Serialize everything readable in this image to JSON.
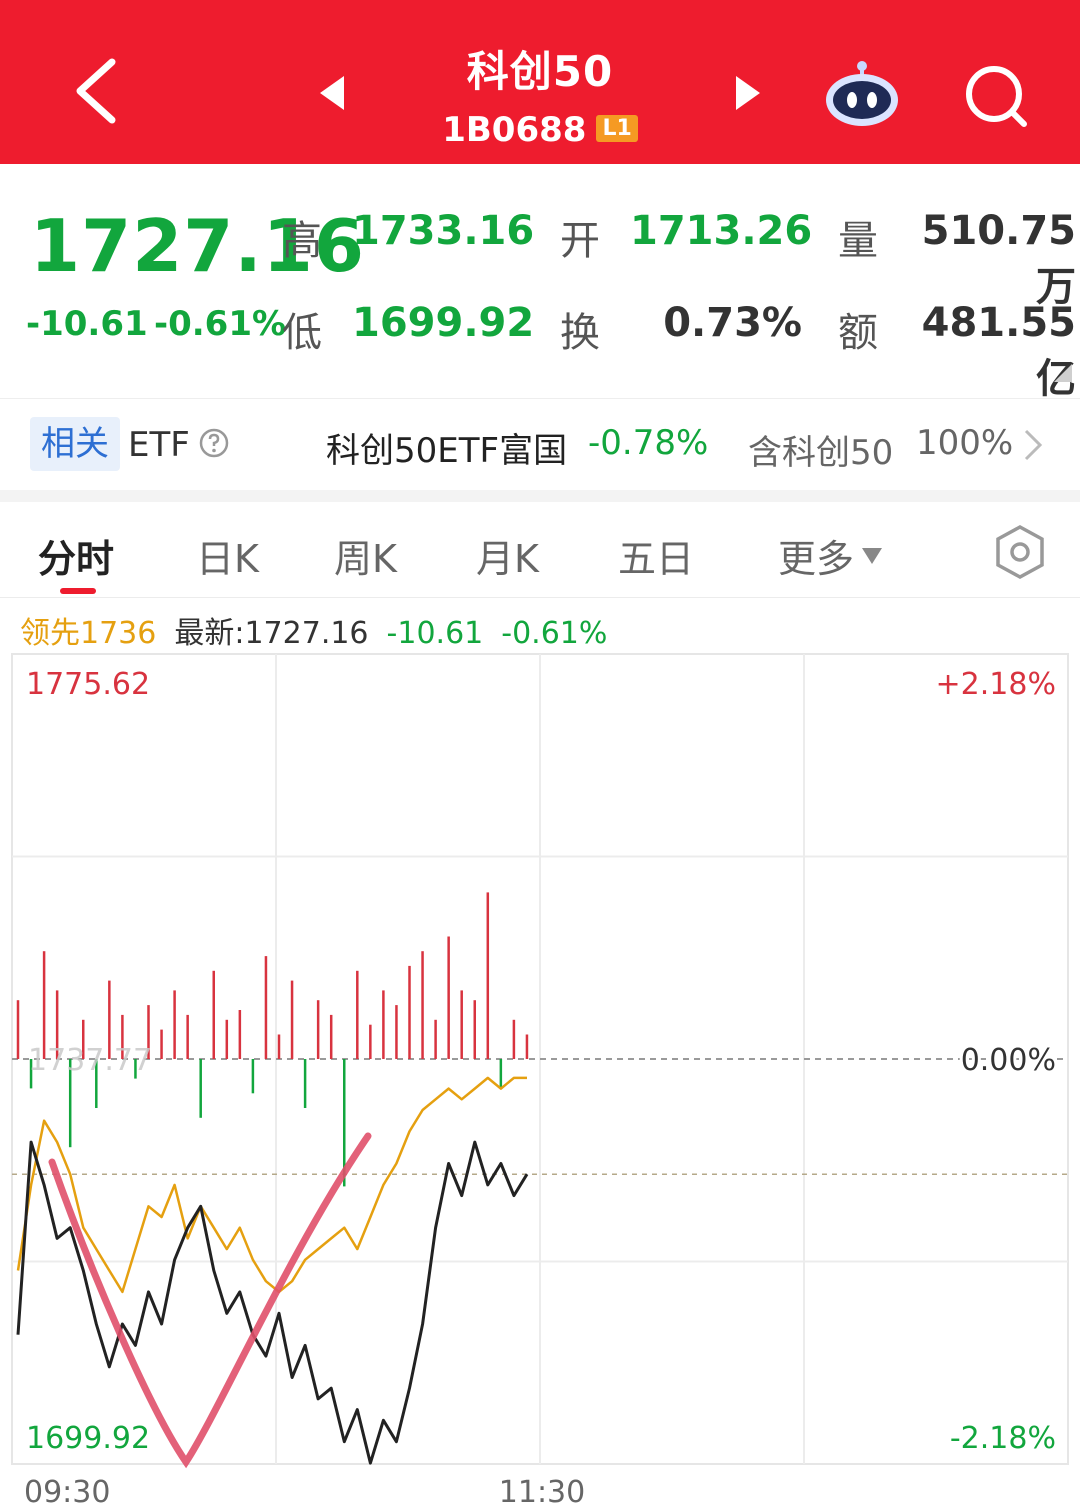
{
  "header": {
    "title": "科创50",
    "code": "1B0688",
    "code_badge": "L1",
    "bg_color": "#ee1c2e"
  },
  "quote": {
    "price": "1727.16",
    "change": "-10.61",
    "change_pct": "-0.61%",
    "high_label": "高",
    "high": "1733.16",
    "open_label": "开",
    "open": "1713.26",
    "volume_label": "量",
    "volume": "510.75万",
    "low_label": "低",
    "low": "1699.92",
    "turnover_label": "换",
    "turnover": "0.73%",
    "amount_label": "额",
    "amount": "481.55亿"
  },
  "etf": {
    "tag": "相关",
    "label": "ETF",
    "name": "科创50ETF富国",
    "change": "-0.78%",
    "contain_label": "含科创50",
    "contain_pct": "100%"
  },
  "tabs": [
    {
      "label": "分时",
      "active": true
    },
    {
      "label": "日K",
      "active": false
    },
    {
      "label": "周K",
      "active": false
    },
    {
      "label": "月K",
      "active": false
    },
    {
      "label": "五日",
      "active": false
    },
    {
      "label": "更多",
      "active": false
    }
  ],
  "info_line": {
    "lead": "领先1736",
    "newest": "最新:1727.16",
    "change": "-10.61",
    "change_pct": "-0.61%"
  },
  "chart_data": {
    "type": "line",
    "y_max_label": "1775.62",
    "y_min_label": "1699.92",
    "y_max_pct": "+2.18%",
    "y_min_pct": "-2.18%",
    "zero_pct": "0.00%",
    "prev_close_label": "1737.77",
    "ylim": [
      1699.92,
      1775.62
    ],
    "prev_close": 1737.77,
    "x_labels": [
      "09:30",
      "11:30"
    ],
    "total_minutes": 240,
    "price_series": [
      1712,
      1730,
      1726,
      1721,
      1722,
      1718,
      1713,
      1709,
      1713,
      1711,
      1716,
      1713,
      1719,
      1722,
      1724,
      1718,
      1714,
      1716,
      1712,
      1710,
      1714,
      1708,
      1711,
      1706,
      1707,
      1702,
      1705,
      1700,
      1704,
      1702,
      1707,
      1713,
      1722,
      1728,
      1725,
      1730,
      1726,
      1728,
      1725,
      1727
    ],
    "lead_series": [
      1718,
      1726,
      1732,
      1730,
      1727,
      1722,
      1720,
      1718,
      1716,
      1720,
      1724,
      1723,
      1726,
      1721,
      1724,
      1722,
      1720,
      1722,
      1719,
      1717,
      1716,
      1717,
      1719,
      1720,
      1721,
      1722,
      1720,
      1723,
      1726,
      1728,
      1731,
      1733,
      1734,
      1735,
      1734,
      1735,
      1736,
      1735,
      1736,
      1736
    ],
    "volume_bars": [
      12,
      -6,
      22,
      14,
      -18,
      8,
      -10,
      16,
      9,
      -4,
      11,
      6,
      14,
      9,
      -12,
      18,
      8,
      10,
      -7,
      21,
      5,
      16,
      -10,
      12,
      9,
      -26,
      18,
      7,
      14,
      11,
      19,
      22,
      8,
      25,
      14,
      12,
      34,
      -6,
      8,
      5
    ],
    "colors": {
      "price_line": "#222222",
      "lead_line": "#e5a010",
      "vol_up": "#d8333f",
      "vol_down": "#12a63d",
      "annotation": "#e0506a",
      "up_text": "#d8333f",
      "down_text": "#12a63d"
    }
  }
}
